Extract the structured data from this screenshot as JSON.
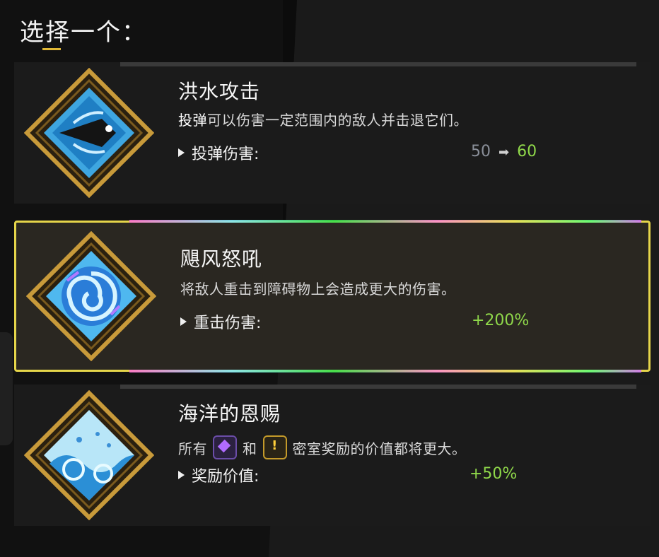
{
  "header": {
    "title": "选择一个："
  },
  "colors": {
    "accent": "#e5d54a",
    "value_green": "#8fd84a",
    "value_old": "#8a8f99"
  },
  "cards": [
    {
      "title": "洪水攻击",
      "desc_highlight": "投弹",
      "desc_rest": "可以伤害一定范围内的敌人并击退它们。",
      "stat_label": "投弹伤害:",
      "old_value": "50",
      "new_value": "60",
      "icon": "flood-fish-icon"
    },
    {
      "title": "飓风怒吼",
      "desc": "将敌人重击到障碍物上会造成更大的伤害。",
      "stat_label": "重击伤害:",
      "new_value": "+200%",
      "icon": "whirlpool-icon",
      "selected": true
    },
    {
      "title": "海洋的恩赐",
      "desc_part1": "所有",
      "desc_and": "和",
      "desc_part2": "密室奖励的价值都将更大。",
      "stat_label": "奖励价值:",
      "new_value": "+50%",
      "icon": "ocean-waves-icon",
      "inline_icons": [
        "darkness-gem-icon",
        "chthonic-key-icon"
      ]
    }
  ]
}
